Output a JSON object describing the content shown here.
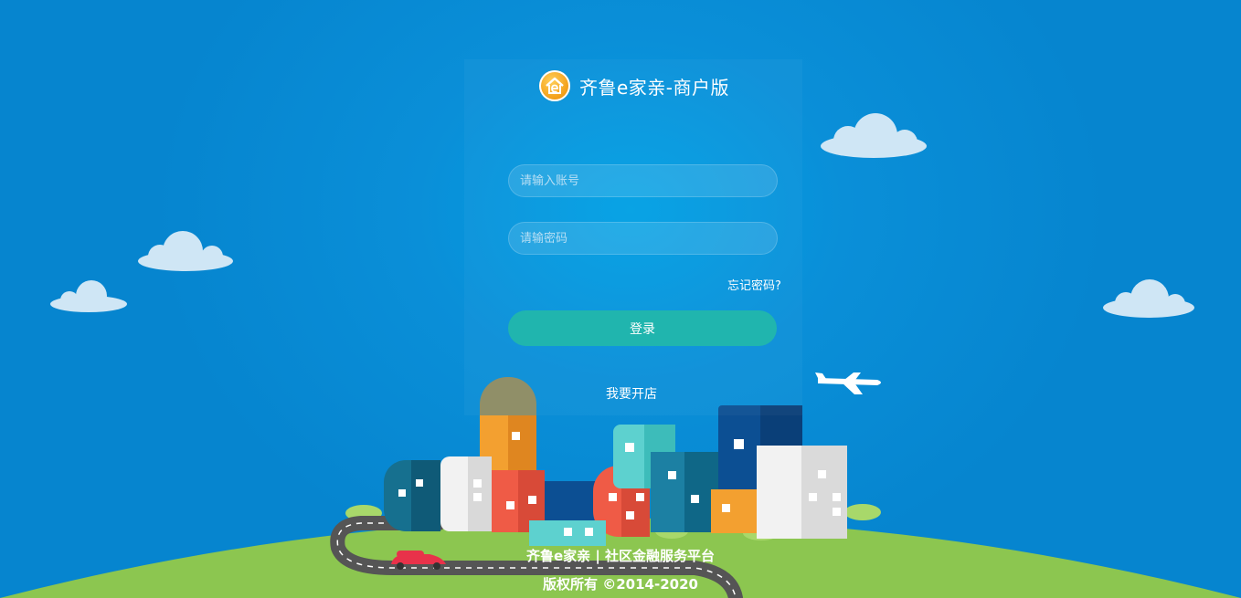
{
  "app": {
    "title": "齐鲁e家亲-商户版",
    "logo_icon": "house-e-logo-icon"
  },
  "login": {
    "account_placeholder": "请输入账号",
    "password_placeholder": "请输密码",
    "forgot_label": "忘记密码?",
    "submit_label": "登录",
    "open_shop_label": "我要开店"
  },
  "footer": {
    "line1": "齐鲁e家亲 | 社区金融服务平台",
    "line2": "版权所有 ©2014-2020"
  },
  "colors": {
    "background": "#0685cf",
    "button": "#20b5ae",
    "hill": "#8cc650"
  }
}
